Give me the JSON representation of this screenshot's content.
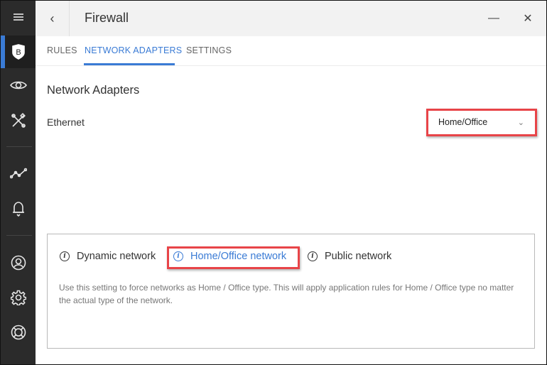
{
  "window": {
    "title": "Firewall",
    "back_icon": "‹",
    "minimize_icon": "—",
    "close_icon": "✕"
  },
  "sidebar": {
    "items": [
      {
        "name": "menu",
        "icon": "hamburger-icon"
      },
      {
        "name": "protection",
        "icon": "bitdefender-shield-icon",
        "active": true,
        "glyph": "B"
      },
      {
        "name": "privacy",
        "icon": "eye-icon"
      },
      {
        "name": "utilities",
        "icon": "tools-icon"
      },
      {
        "name": "reports",
        "icon": "activity-graph-icon"
      },
      {
        "name": "notifications",
        "icon": "bell-icon"
      },
      {
        "name": "account",
        "icon": "user-icon"
      },
      {
        "name": "settings",
        "icon": "gear-icon"
      },
      {
        "name": "support",
        "icon": "lifebuoy-icon"
      }
    ]
  },
  "tabs": [
    {
      "label": "RULES",
      "active": false
    },
    {
      "label": "NETWORK ADAPTERS",
      "active": true
    },
    {
      "label": "SETTINGS",
      "active": false
    }
  ],
  "content": {
    "section_title": "Network Adapters",
    "adapter": {
      "label": "Ethernet",
      "selected_value": "Home/Office",
      "dropdown_icon": "chevron-down-icon"
    },
    "network_options": [
      {
        "label": "Dynamic network",
        "selected": false
      },
      {
        "label": "Home/Office network",
        "selected": true
      },
      {
        "label": "Public network",
        "selected": false
      }
    ],
    "description": "Use this setting to force networks as Home / Office type. This will apply application rules for Home / Office type no matter the actual type of the network."
  },
  "colors": {
    "accent": "#3a7bd5",
    "highlight": "#e84448",
    "sidebar_bg": "#2b2b2b"
  }
}
